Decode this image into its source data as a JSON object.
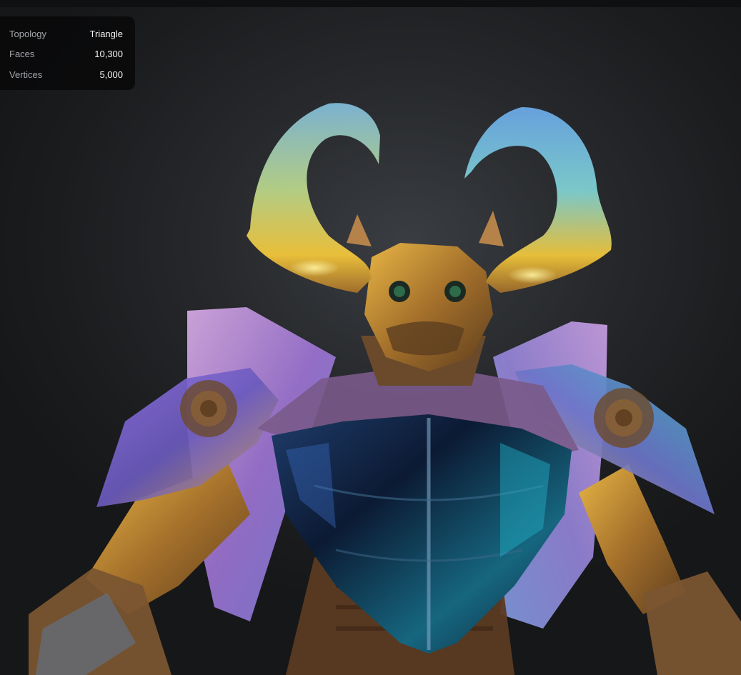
{
  "model_info": {
    "rows": [
      {
        "label": "Topology",
        "value": "Triangle"
      },
      {
        "label": "Faces",
        "value": "10,300"
      },
      {
        "label": "Vertices",
        "value": "5,000"
      }
    ]
  },
  "colors": {
    "background": "#1a1b1d",
    "panel": "#0a0a0b",
    "label_text": "#a3a6ab",
    "value_text": "#f2f3f5"
  },
  "viewport": {
    "subject": "3d-model-crystal-beetle-robot"
  }
}
